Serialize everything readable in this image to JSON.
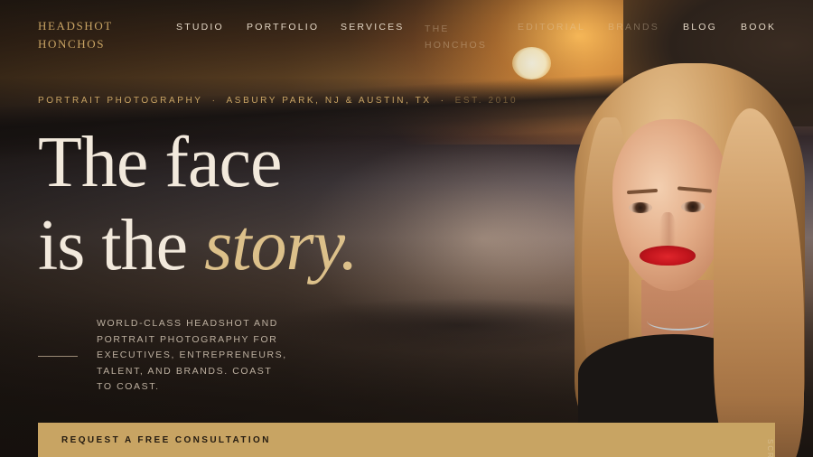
{
  "brand": {
    "logo_line1": "HEADSHOT",
    "logo_line2": "HONCHOS"
  },
  "nav": {
    "items": [
      {
        "label": "STUDIO"
      },
      {
        "label": "PORTFOLIO"
      },
      {
        "label": "SERVICES"
      },
      {
        "label": "THE HONCHOS"
      },
      {
        "label": "EDITORIAL"
      },
      {
        "label": "BRANDS"
      },
      {
        "label": "BLOG"
      },
      {
        "label": "BOOK"
      }
    ]
  },
  "hero": {
    "tagline_a": "PORTRAIT PHOTOGRAPHY",
    "tagline_b": "ASBURY PARK, NJ & AUSTIN, TX",
    "tagline_c": "EST. 2010",
    "separator": "·",
    "headline_line1": "The face",
    "headline_line2_plain": "is the ",
    "headline_line2_accent": "story.",
    "subcopy": "WORLD-CLASS HEADSHOT AND PORTRAIT PHOTOGRAPHY FOR EXECUTIVES, ENTREPRENEURS, TALENT, AND BRANDS. COAST TO COAST."
  },
  "cta": {
    "label": "REQUEST A FREE CONSULTATION"
  },
  "scroll_hint": "SCROLL",
  "colors": {
    "accent_gold": "#c8a463",
    "headline_cream": "#f2e9dc",
    "accent_italic": "#dcc08a"
  }
}
